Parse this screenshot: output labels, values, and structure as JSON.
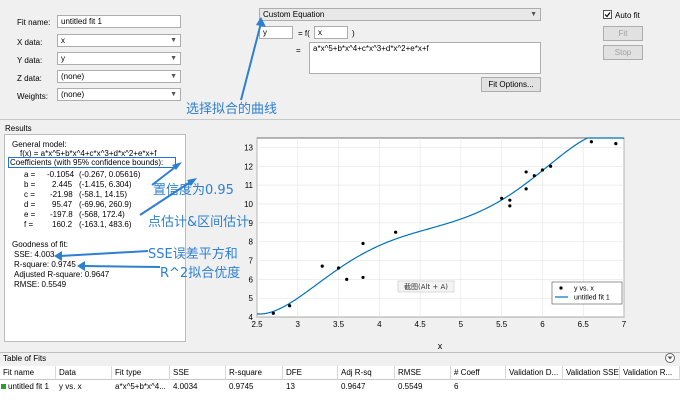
{
  "fit_form": {
    "fit_name_label": "Fit name:",
    "fit_name_value": "untitled fit 1",
    "x_label": "X data:",
    "x_value": "x",
    "y_label": "Y data:",
    "y_value": "y",
    "z_label": "Z data:",
    "z_value": "(none)",
    "weights_label": "Weights:",
    "weights_value": "(none)"
  },
  "equation": {
    "type_value": "Custom Equation",
    "lhs": "y",
    "eq_f": "= f(",
    "var": "x",
    "close_paren": ")",
    "eq_sign": "=",
    "expression": "a*x^5+b*x^4+c*x^3+d*x^2+e*x+f",
    "fit_options_label": "Fit Options..."
  },
  "controls": {
    "auto_fit_label": "Auto fit",
    "fit_label": "Fit",
    "stop_label": "Stop"
  },
  "results": {
    "title": "Results",
    "general_model": "General model:",
    "model_formula": "f(x) = a*x^5+b*x^4+c*x^3+d*x^2+e*x+f",
    "coef_header": "Coefficients (with 95% confidence bounds):",
    "coefficients": [
      {
        "name": "a =",
        "value": "-0.1054",
        "bounds": "(-0.267, 0.05616)"
      },
      {
        "name": "b =",
        "value": "2.445",
        "bounds": "(-1.415, 6.304)"
      },
      {
        "name": "c =",
        "value": "-21.98",
        "bounds": "(-58.1, 14.15)"
      },
      {
        "name": "d =",
        "value": "95.47",
        "bounds": "(-69.96, 260.9)"
      },
      {
        "name": "e =",
        "value": "-197.8",
        "bounds": "(-568, 172.4)"
      },
      {
        "name": "f =",
        "value": "160.2",
        "bounds": "(-163.1, 483.6)"
      }
    ],
    "goodness_title": "Goodness of fit:",
    "sse": "SSE: 4.003",
    "rsquare": "R-square: 0.9745",
    "adj_rsquare": "Adjusted R-square: 0.9647",
    "rmse": "RMSE: 0.5549"
  },
  "annotations": {
    "select_curve": "选择拟合的曲线",
    "confidence": "置信度为0.95",
    "point_estimate": "点估计&区间估计",
    "sse_note": "SSE误差平方和",
    "r2_note": "R^2拟合优度"
  },
  "plot": {
    "screenshot_hint": "截图(Alt + A)",
    "legend_points": "y vs. x",
    "legend_fit": "untitled fit 1"
  },
  "chart_data": {
    "type": "scatter",
    "xlabel": "x",
    "ylabel": "",
    "xlim": [
      2.5,
      7
    ],
    "ylim": [
      4,
      13.5
    ],
    "x_ticks": [
      2.5,
      3,
      3.5,
      4,
      4.5,
      5,
      5.5,
      6,
      6.5,
      7
    ],
    "y_ticks": [
      4,
      5,
      6,
      7,
      8,
      9,
      10,
      11,
      12,
      13
    ],
    "grid": true,
    "legend": "bottom-right",
    "points_x": [
      2.7,
      2.9,
      3.3,
      3.5,
      3.6,
      3.8,
      3.8,
      4.2,
      5.5,
      5.6,
      5.6,
      5.8,
      5.8,
      5.9,
      6.0,
      6.1,
      6.6,
      6.9
    ],
    "points_y": [
      4.2,
      4.6,
      6.7,
      6.6,
      6.0,
      6.1,
      7.9,
      8.5,
      10.3,
      9.9,
      10.2,
      10.8,
      11.7,
      11.5,
      11.8,
      12.0,
      13.3,
      13.2
    ],
    "fit_coefficients": [
      -0.1054,
      2.445,
      -21.98,
      95.47,
      -197.8,
      160.2
    ],
    "fit_color": "#0072bd",
    "point_color": "#000000"
  },
  "table": {
    "title": "Table of Fits",
    "headers": [
      "Fit name",
      "Data",
      "Fit type",
      "SSE",
      "R-square",
      "DFE",
      "Adj R-sq",
      "RMSE",
      "# Coeff",
      "Validation D...",
      "Validation SSE",
      "Validation R..."
    ],
    "rows": [
      [
        "untitled fit 1",
        "y vs. x",
        "a*x^5+b*x^4...",
        "4.0034",
        "0.9745",
        "13",
        "0.9647",
        "0.5549",
        "6",
        "",
        "",
        ""
      ]
    ]
  },
  "colors": {
    "annotation": "#2e7fd0",
    "highlight_border": "#1f74d6",
    "fit_line": "#0072bd"
  }
}
